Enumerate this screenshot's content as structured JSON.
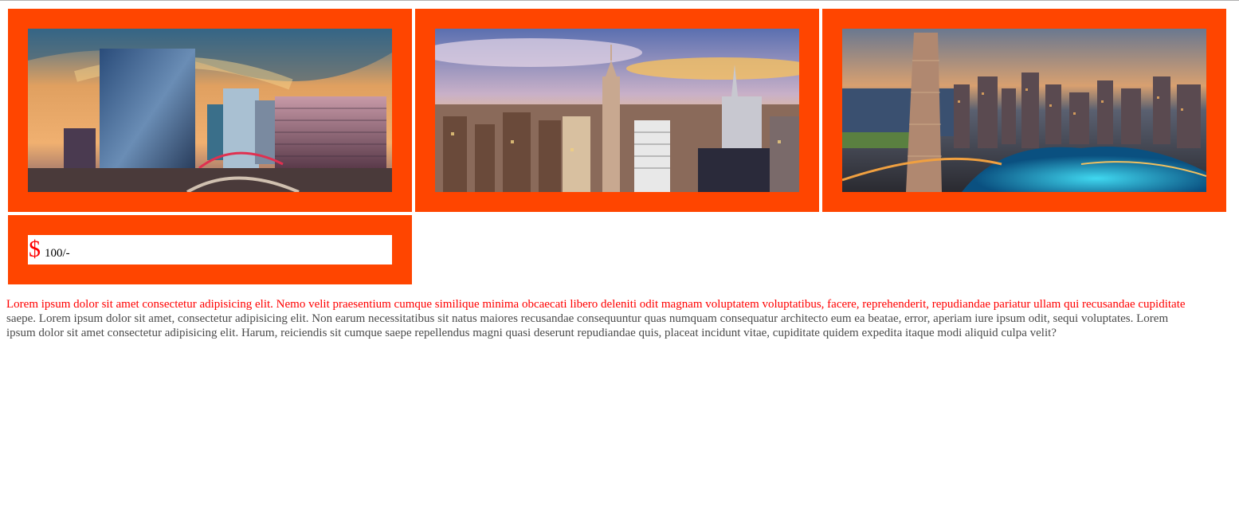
{
  "gallery": [
    {
      "image": "office-buildings-sunset-photo"
    },
    {
      "image": "new-york-skyline-photo"
    },
    {
      "image": "dubai-marina-night-photo"
    }
  ],
  "price": {
    "symbol": "$",
    "value": "100/-"
  },
  "description": {
    "line1": "Lorem ipsum dolor sit amet consectetur adipisicing elit. Nemo velit praesentium cumque similique minima obcaecati libero deleniti odit magnam voluptatem voluptatibus, facere, reprehenderit, repudiandae pariatur ullam qui recusandae cupiditate",
    "line2": "saepe. Lorem ipsum dolor sit amet, consectetur adipisicing elit. Non earum necessitatibus sit natus maiores recusandae consequuntur quas numquam consequatur architecto eum ea beatae, error, aperiam iure ipsum odit, sequi voluptates. Lorem",
    "line3": "ipsum dolor sit amet consectetur adipisicing elit. Harum, reiciendis sit cumque saepe repellendus magni quasi deserunt repudiandae quis, placeat incidunt vitae, cupiditate quidem expedita itaque modi aliquid culpa velit?"
  },
  "colors": {
    "card_background": "#ff4500",
    "price_symbol": "#ff0000",
    "first_line_text": "#ff0000",
    "body_text": "#4a4a4a"
  }
}
